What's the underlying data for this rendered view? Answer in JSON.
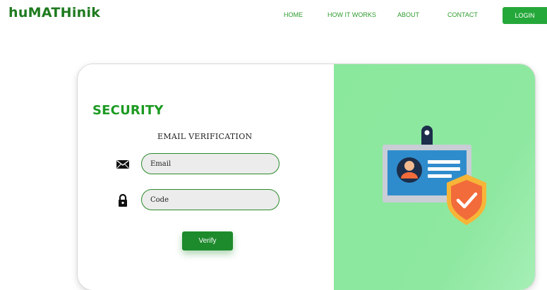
{
  "brand": {
    "logo_text": "huMATHinik"
  },
  "nav": {
    "links": [
      "HOME",
      "HOW IT WORKS",
      "ABOUT",
      "CONTACT"
    ],
    "login_label": "LOGIN"
  },
  "form": {
    "title": "SECURITY",
    "subtitle": "EMAIL VERIFICATION",
    "email_placeholder": "Email",
    "code_placeholder": "Code",
    "verify_label": "Verify",
    "email_icon": "envelope-icon",
    "code_icon": "lock-icon"
  },
  "illustration": {
    "icon": "id-badge-with-shield-check"
  },
  "colors": {
    "brand_green": "#1f7a1f",
    "accent_green": "#25a83a",
    "panel_green": "#8ee8a0",
    "shield_orange": "#f26b3a"
  }
}
